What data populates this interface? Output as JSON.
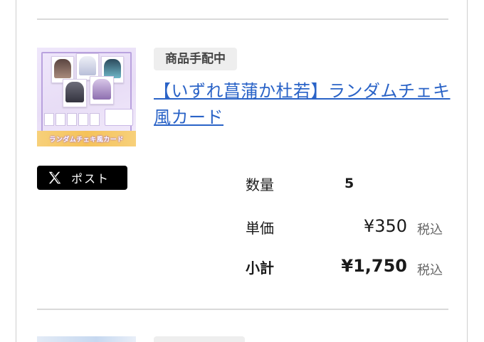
{
  "item": {
    "status_badge": "商品手配中",
    "title": "【いずれ菖蒲か杜若】ランダムチェキ風カード",
    "thumbnail": {
      "banner_text": "ランダムチェキ風カード",
      "accent_color": "#b9a2de",
      "banner_color": "#f5c25a"
    },
    "post_button": {
      "icon": "x-logo-icon",
      "label": "ポスト"
    },
    "quantity": {
      "label": "数量",
      "value": "5"
    },
    "unit_price": {
      "label": "単価",
      "value": "¥350",
      "tax_note": "税込"
    },
    "subtotal": {
      "label": "小計",
      "value": "¥1,750",
      "tax_note": "税込"
    }
  },
  "colors": {
    "link": "#2a63c7",
    "badge_bg": "#eeeeee",
    "post_button_bg": "#000000",
    "divider": "#dadada"
  }
}
